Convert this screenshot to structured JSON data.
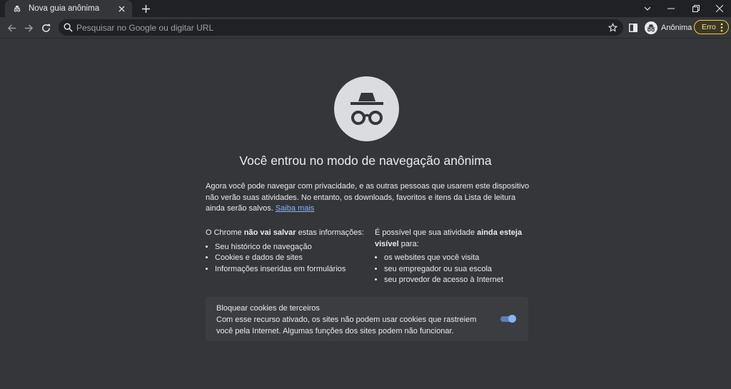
{
  "tab": {
    "title": "Nova guia anônima"
  },
  "omnibox": {
    "placeholder": "Pesquisar no Google ou digitar URL"
  },
  "profile": {
    "label": "Anônima"
  },
  "error": {
    "label": "Erro"
  },
  "page": {
    "headline": "Você entrou no modo de navegação anônima",
    "intro": "Agora você pode navegar com privacidade, e as outras pessoas que usarem este dispositivo não verão suas atividades. No entanto, os downloads, favoritos e itens da Lista de leitura ainda serão salvos.",
    "learn_more": "Saiba mais",
    "left": {
      "heading_pre": "O Chrome ",
      "heading_bold": "não vai salvar",
      "heading_post": " estas informações:",
      "items": [
        "Seu histórico de navegação",
        "Cookies e dados de sites",
        "Informações inseridas em formulários"
      ]
    },
    "right": {
      "heading_pre": "É possível que sua atividade ",
      "heading_bold": "ainda esteja visível",
      "heading_post": " para:",
      "items": [
        "os websites que você visita",
        "seu empregador ou sua escola",
        "seu provedor de acesso à Internet"
      ]
    },
    "cookies": {
      "title": "Bloquear cookies de terceiros",
      "description": "Com esse recurso ativado, os sites não podem usar cookies que rastreiem você pela Internet. Algumas funções dos sites podem não funcionar.",
      "enabled": true
    }
  },
  "colors": {
    "background": "#35363a",
    "tabstrip": "#202124",
    "link": "#8ab4f8",
    "error_border": "#f2c94c"
  }
}
